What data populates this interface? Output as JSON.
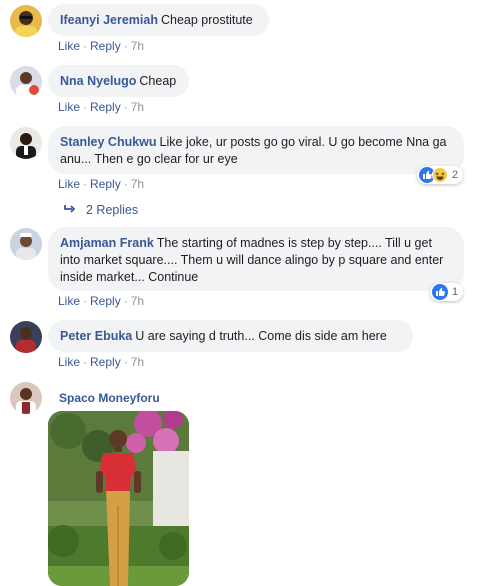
{
  "actions": {
    "like_label": "Like",
    "reply_label": "Reply",
    "separator": "·"
  },
  "comments": [
    {
      "author": "Ifeanyi Jeremiah",
      "text": "Cheap prostitute",
      "time": "7h"
    },
    {
      "author": "Nna Nyelugo",
      "text": "Cheap",
      "time": "7h"
    },
    {
      "author": "Stanley Chukwu",
      "text": "Like joke, ur posts go go viral. U go become Nna ga anu... Then e go clear for ur eye",
      "time": "7h",
      "reactions": {
        "types": [
          "like",
          "haha"
        ],
        "count": "2"
      }
    },
    {
      "author": "Amjaman Frank",
      "text": "The starting of madnes is step by step.... Till u get into market square.... Them u will dance alingo by p square and enter inside market... Continue",
      "time": "7h",
      "reactions": {
        "types": [
          "like"
        ],
        "count": "1"
      }
    },
    {
      "author": "Peter Ebuka",
      "text": "U are saying d truth... Come dis side am here",
      "time": "7h"
    },
    {
      "author": "Spaco Moneyforu",
      "text": "",
      "attachment": "photo"
    }
  ],
  "replies_link": {
    "label": "2 Replies",
    "icon": "reply-arrow-icon"
  },
  "colors": {
    "link": "#385898",
    "bubble_bg": "#f2f3f5",
    "like_blue": "#2e76f0",
    "meta_gray": "#90949c"
  }
}
